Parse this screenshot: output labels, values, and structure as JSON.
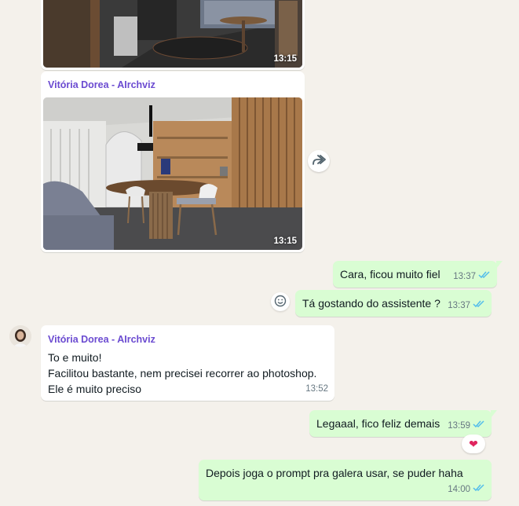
{
  "messages": {
    "image1": {
      "time": "13:15"
    },
    "image2": {
      "sender": "Vitória Dorea - AIrchviz",
      "time": "13:15"
    },
    "out1": {
      "text": "Cara, ficou muito fiel",
      "time": "13:37"
    },
    "out2": {
      "text": "Tá gostando do assistente ?",
      "time": "13:37"
    },
    "in1": {
      "sender": "Vitória Dorea - AIrchviz",
      "line1": "To e muito!",
      "line2": "Facilitou bastante, nem precisei recorrer ao photoshop.",
      "line3": "Ele é muito preciso",
      "time": "13:52"
    },
    "out3": {
      "text": "Legaaal, fico feliz demais",
      "time": "13:59",
      "reaction": "❤"
    },
    "out4": {
      "text": "Depois joga o prompt pra galera usar, se puder haha",
      "time": "14:00"
    }
  },
  "icons": {
    "forward": "forward-icon",
    "emoji": "smiley-icon",
    "read": "double-check-icon"
  },
  "colors": {
    "outgoing_bubble": "#d9fdd3",
    "incoming_bubble": "#ffffff",
    "sender_name": "#6b4bd1",
    "read_tick": "#53bdeb",
    "background": "#f4f1eb"
  }
}
